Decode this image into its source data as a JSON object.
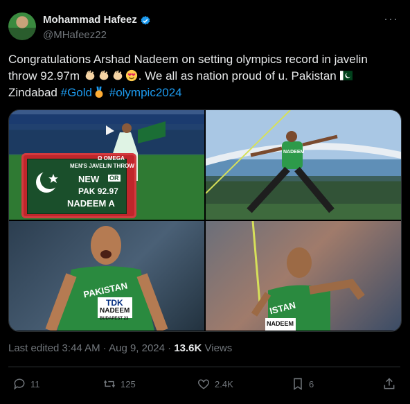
{
  "author": {
    "name": "Mohammad Hafeez",
    "handle": "@MHafeez22"
  },
  "tweet": {
    "text_part1": "Congratulations Arshad Nadeem on setting olympics record in javelin throw 92.97m ",
    "text_part2": ". We all as nation proud of u. Pakistan ",
    "text_part3": "Zindabad ",
    "hashtag_gold": "#Gold",
    "hashtag_olympic": "#olympic2024"
  },
  "media": {
    "board": {
      "brand": "Ω OMEGA",
      "title": "MEN'S JAVELIN THROW",
      "new_label": "NEW",
      "or_label": "OR",
      "result": "PAK 92.97",
      "name": "NADEEM A"
    },
    "jersey_country": "PAKISTAN",
    "jersey_sponsor": "TDK",
    "jersey_name": "NADEEM",
    "jersey_event": "BUDAPEST 23",
    "jersey_name_partial": "NADEEM"
  },
  "meta": {
    "edited": "Last edited 3:44 AM · Aug 9, 2024 · ",
    "views_count": "13.6K",
    "views_label": " Views"
  },
  "actions": {
    "replies": "11",
    "reposts": "125",
    "likes": "2.4K",
    "bookmarks": "6"
  },
  "colors": {
    "background": "#000000",
    "text": "#e7e9ea",
    "muted": "#71767b",
    "link": "#1d9bf0",
    "divider": "#2f3336"
  },
  "icons": [
    "verified-badge-icon",
    "more-icon",
    "reply-icon",
    "repost-icon",
    "like-icon",
    "bookmark-icon",
    "share-icon",
    "clap-emoji",
    "heart-eyes-emoji",
    "pakistan-flag-emoji",
    "medal-emoji"
  ]
}
